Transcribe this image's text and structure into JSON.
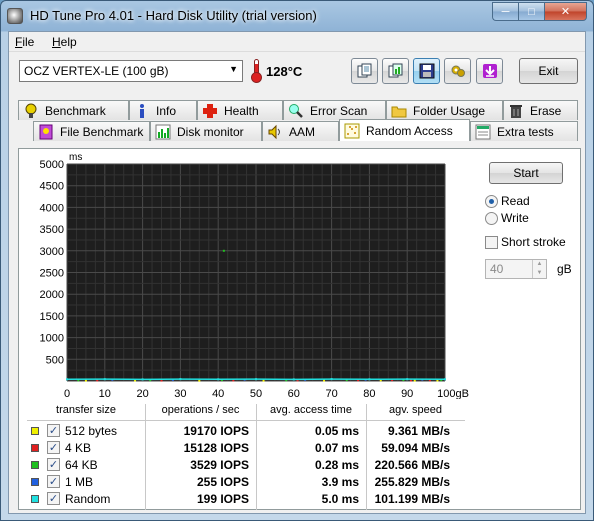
{
  "window": {
    "title": "HD Tune Pro 4.01 - Hard Disk Utility (trial version)"
  },
  "menu": {
    "file": {
      "underlined": "F",
      "rest": "ile"
    },
    "help": {
      "underlined": "H",
      "rest": "elp"
    }
  },
  "toolbar": {
    "drive": "OCZ VERTEX-LE (100 gB)",
    "temperature": "128°C",
    "exit_label": "Exit",
    "icons": [
      "copy-info-icon",
      "copy-screenshot-icon",
      "save-icon",
      "options-icon",
      "download-icon"
    ]
  },
  "tabs_back": [
    {
      "label": "Benchmark",
      "icon": "benchmark-icon"
    },
    {
      "label": "Info",
      "icon": "info-icon"
    },
    {
      "label": "Health",
      "icon": "health-icon"
    },
    {
      "label": "Error Scan",
      "icon": "error-scan-icon"
    },
    {
      "label": "Folder Usage",
      "icon": "folder-icon"
    },
    {
      "label": "Erase",
      "icon": "trash-icon"
    }
  ],
  "tabs_front": [
    {
      "label": "File Benchmark",
      "icon": "file-benchmark-icon"
    },
    {
      "label": "Disk monitor",
      "icon": "disk-monitor-icon"
    },
    {
      "label": "AAM",
      "icon": "speaker-icon"
    },
    {
      "label": "Random Access",
      "icon": "random-access-icon",
      "active": true
    },
    {
      "label": "Extra tests",
      "icon": "extra-tests-icon"
    }
  ],
  "controls": {
    "start_label": "Start",
    "read_label": "Read",
    "write_label": "Write",
    "mode": "Read",
    "short_stroke_label": "Short stroke",
    "short_stroke_checked": false,
    "short_stroke_value": "40",
    "short_stroke_unit": "gB"
  },
  "table": {
    "headers": {
      "size": "transfer size",
      "ops": "operations / sec",
      "access": "avg. access time",
      "speed": "agv. speed"
    },
    "rows": [
      {
        "size": "512 bytes",
        "ops": "19170 IOPS",
        "access": "0.05 ms",
        "speed": "9.361 MB/s",
        "color": "#f0f000",
        "checked": true
      },
      {
        "size": "4 KB",
        "ops": "15128 IOPS",
        "access": "0.07 ms",
        "speed": "59.094 MB/s",
        "color": "#e02020",
        "checked": true
      },
      {
        "size": "64 KB",
        "ops": "3529 IOPS",
        "access": "0.28 ms",
        "speed": "220.566 MB/s",
        "color": "#20c020",
        "checked": true
      },
      {
        "size": "1 MB",
        "ops": "255 IOPS",
        "access": "3.9 ms",
        "speed": "255.829 MB/s",
        "color": "#2060e0",
        "checked": true
      },
      {
        "size": "Random",
        "ops": "199 IOPS",
        "access": "5.0 ms",
        "speed": "101.199 MB/s",
        "color": "#20e0e0",
        "checked": true
      }
    ]
  },
  "chart_data": {
    "type": "scatter",
    "title": "",
    "ylabel": "ms",
    "xlabel": "gB",
    "xlim": [
      0,
      100
    ],
    "ylim": [
      0,
      5000
    ],
    "x_ticks": [
      "0",
      "10",
      "20",
      "30",
      "40",
      "50",
      "60",
      "70",
      "80",
      "90",
      "100gB"
    ],
    "y_ticks": [
      "500",
      "1000",
      "1500",
      "2000",
      "2500",
      "3000",
      "3500",
      "4000",
      "4500",
      "5000"
    ],
    "grid": true,
    "legend": "table-below",
    "background": "#1e1e1e",
    "series": [
      {
        "name": "512 bytes",
        "color": "#f0f000",
        "points": [
          [
            5,
            10
          ],
          [
            18,
            12
          ],
          [
            35,
            8
          ],
          [
            52,
            10
          ],
          [
            68,
            12
          ],
          [
            83,
            15
          ],
          [
            92,
            10
          ],
          [
            98,
            12
          ]
        ]
      },
      {
        "name": "4 KB",
        "color": "#e02020",
        "points": [
          [
            8,
            14
          ],
          [
            25,
            10
          ],
          [
            44,
            12
          ],
          [
            61,
            14
          ],
          [
            77,
            18
          ],
          [
            86,
            20
          ],
          [
            91,
            12
          ],
          [
            96,
            16
          ]
        ]
      },
      {
        "name": "64 KB",
        "color": "#20c020",
        "points": [
          [
            3,
            15
          ],
          [
            22,
            18
          ],
          [
            41,
            20
          ],
          [
            41.5,
            3000
          ],
          [
            58,
            16
          ],
          [
            74,
            20
          ],
          [
            89,
            22
          ],
          [
            99,
            18
          ]
        ]
      },
      {
        "name": "1 MB",
        "color": "#2060e0",
        "points": [
          [
            12,
            30
          ],
          [
            28,
            26
          ],
          [
            47,
            32
          ],
          [
            63,
            28
          ],
          [
            79,
            30
          ],
          [
            94,
            34
          ]
        ]
      },
      {
        "name": "Random",
        "color": "#20e0e0",
        "points": [
          [
            0,
            40
          ],
          [
            10,
            42
          ],
          [
            20,
            38
          ],
          [
            30,
            44
          ],
          [
            40,
            40
          ],
          [
            50,
            42
          ],
          [
            60,
            38
          ],
          [
            70,
            44
          ],
          [
            80,
            40
          ],
          [
            90,
            42
          ],
          [
            100,
            40
          ]
        ]
      }
    ]
  }
}
